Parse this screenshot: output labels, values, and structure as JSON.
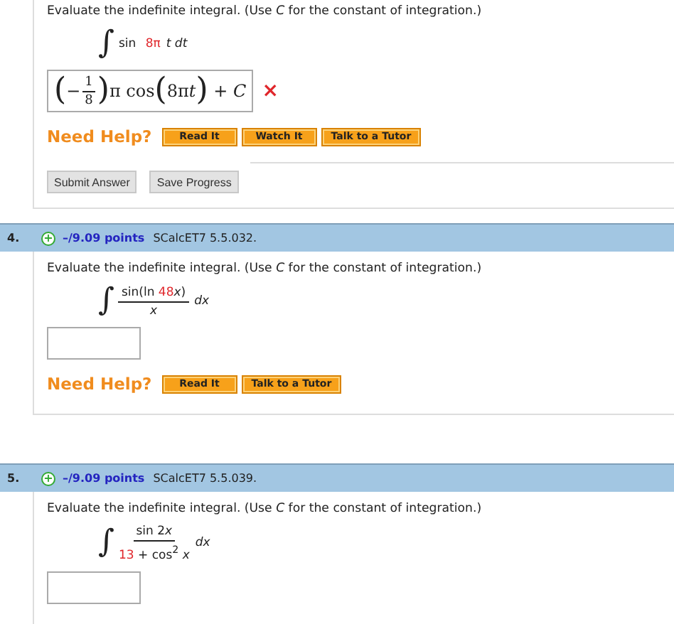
{
  "partial_question": {
    "prompt": "Evaluate the indefinite integral. (Use *C* for the constant of integration.)",
    "integral": {
      "sign": "∫",
      "body": [
        {
          "text": "sin ",
          "param": false
        },
        {
          "text": "8π",
          "param": true
        },
        {
          "text": "*t dt*",
          "param": false
        }
      ]
    },
    "answer": {
      "correct": false,
      "mark": "×",
      "parts": [
        {
          "kind": "paren",
          "text": "("
        },
        {
          "kind": "text",
          "text": "−"
        },
        {
          "kind": "fraction",
          "numerator": "1",
          "denominator": "8"
        },
        {
          "kind": "paren",
          "text": ")"
        },
        {
          "kind": "text",
          "text": "π cos"
        },
        {
          "kind": "paren",
          "text": "("
        },
        {
          "kind": "text",
          "text": "8π"
        },
        {
          "kind": "text",
          "text": "*t*"
        },
        {
          "kind": "paren",
          "text": ")"
        },
        {
          "kind": "text",
          "text": " + *C*"
        }
      ]
    },
    "help_label": "Need Help?",
    "help_buttons": [
      "Read It",
      "Watch It",
      "Talk to a Tutor"
    ],
    "actions": [
      "Submit Answer",
      "Save Progress"
    ]
  },
  "questions": [
    {
      "number": "4.",
      "expand": "+",
      "points": "–/9.09 points",
      "source": "SCalcET7 5.5.032.",
      "prompt": "Evaluate the indefinite integral. (Use *C* for the constant of integration.)",
      "integral": {
        "sign": "∫",
        "numerator": [
          {
            "text": "sin(ln ",
            "param": false
          },
          {
            "text": "48",
            "param": true
          },
          {
            "text": "*x*)",
            "param": false
          }
        ],
        "denominator": [
          {
            "text": "*x*",
            "param": false
          }
        ],
        "differential": "*dx*"
      },
      "help_label": "Need Help?",
      "help_buttons": [
        "Read It",
        "Talk to a Tutor"
      ]
    },
    {
      "number": "5.",
      "expand": "+",
      "points": "–/9.09 points",
      "source": "SCalcET7 5.5.039.",
      "prompt": "Evaluate the indefinite integral. (Use *C* for the constant of integration.)",
      "integral": {
        "sign": "∫",
        "numerator": [
          {
            "text": "sin 2",
            "param": false
          },
          {
            "text": "*x*",
            "param": false
          }
        ],
        "denominator": [
          {
            "text": "13",
            "param": true
          },
          {
            "text": " + cos$^{2}$ *x*",
            "param": false
          }
        ],
        "differential": "*dx*"
      }
    }
  ]
}
